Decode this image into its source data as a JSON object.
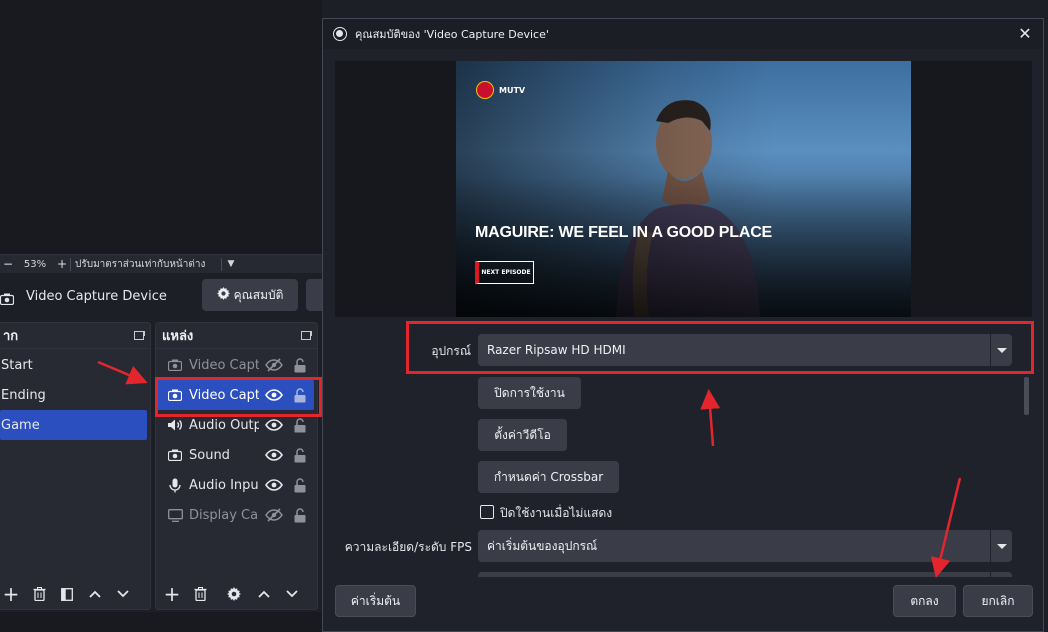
{
  "zoombar": {
    "minus": "−",
    "zoom": "53%",
    "plus": "+",
    "fit_label": "ปรับมาตราส่วนเท่ากับหน้าต่าง"
  },
  "source_toolbar": {
    "source_name": "Video Capture Device",
    "properties_label": "คุณสมบัติ"
  },
  "scenes_dock": {
    "title": "าก",
    "items": [
      {
        "label": "Start",
        "selected": false
      },
      {
        "label": "Ending",
        "selected": false
      },
      {
        "label": "Game",
        "selected": true
      }
    ]
  },
  "sources_dock": {
    "title": "แหล่ง",
    "items": [
      {
        "label": "Video Captu",
        "icon": "camera-icon",
        "visible": false,
        "selected": false,
        "dim": true
      },
      {
        "label": "Video Captu",
        "icon": "camera-icon",
        "visible": true,
        "selected": true,
        "dim": false
      },
      {
        "label": "Audio Outp",
        "icon": "speaker-icon",
        "visible": true,
        "selected": false,
        "dim": false
      },
      {
        "label": "Sound",
        "icon": "camera-icon",
        "visible": true,
        "selected": false,
        "dim": false
      },
      {
        "label": "Audio Input",
        "icon": "microphone-icon",
        "visible": true,
        "selected": false,
        "dim": false
      },
      {
        "label": "Display Cap",
        "icon": "monitor-icon",
        "visible": false,
        "selected": false,
        "dim": true
      }
    ]
  },
  "dialog": {
    "title": "คุณสมบัติของ 'Video Capture Device'",
    "preview": {
      "logo_text": "MUTV",
      "headline": "MAGUIRE: WE FEEL IN A GOOD PLACE",
      "next_episode": "NEXT EPISODE"
    },
    "form": {
      "device_label": "อุปกรณ์",
      "device_value": "Razer Ripsaw HD HDMI",
      "deactivate_button": "ปิดการใช้งาน",
      "video_config_button": "ตั้งค่าวีดีโอ",
      "crossbar_button": "กำหนดค่า Crossbar",
      "deactivate_hidden_label": "ปิดใช้งานเมื่อไม่แสดง",
      "resolution_label": "ความละเอียด/ระดับ FPS",
      "resolution_value": "ค่าเริ่มต้นของอุปกรณ์"
    },
    "footer": {
      "defaults_button": "ค่าเริ่มต้น",
      "ok_button": "ตกลง",
      "cancel_button": "ยกเลิก"
    }
  },
  "colors": {
    "accent_selected": "#2b4fbf",
    "annotation_red": "#e3262d",
    "button_bg": "#3a3c48"
  }
}
